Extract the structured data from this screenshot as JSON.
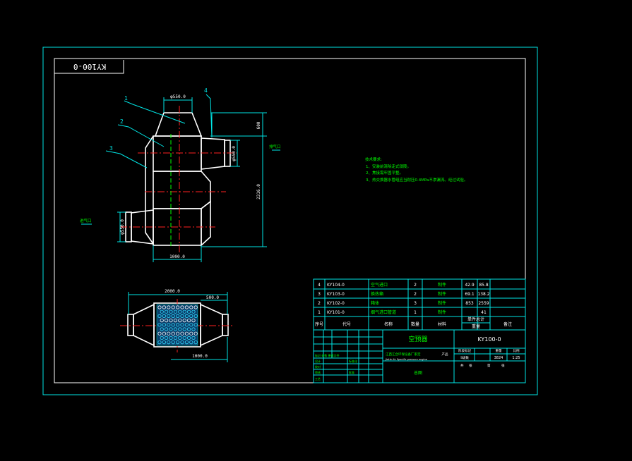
{
  "drawing": {
    "code_rotated": "KY100-0",
    "leaders": [
      "1",
      "2",
      "3",
      "4"
    ],
    "dims": {
      "top_diameter": "φ550.0",
      "outlet_diameter": "φ550.0",
      "inlet_diameter": "φ550.0",
      "small_height": "600",
      "total_height": "2316.0",
      "width_bottom": "1000.0",
      "lower_length": "2000.0",
      "lower_right": "500.0",
      "lower_bottom": "1000.0"
    },
    "flow_out": "排气口",
    "flow_in": "进气口"
  },
  "notes": {
    "title": "技术要求:",
    "lines": [
      "1、安装前清除走式锁陵。",
      "2、焦接需牢固平整。",
      "3、热交换器水管组应当耐压0.4MPa不渗漏流。经过试验。"
    ]
  },
  "bom": {
    "rows": [
      {
        "no": "4",
        "code": "KY104-0",
        "name": "空气进口",
        "qty": "2",
        "mat": "制件",
        "w1": "42.9",
        "w2": "85.8"
      },
      {
        "no": "3",
        "code": "KY103-0",
        "name": "换热箱",
        "qty": "2",
        "mat": "制件",
        "w1": "69.1",
        "w2": "138.2"
      },
      {
        "no": "2",
        "code": "KY102-0",
        "name": "箱体",
        "qty": "3",
        "mat": "制件",
        "w1": "853",
        "w2": "2559"
      },
      {
        "no": "1",
        "code": "KY101-0",
        "name": "烟气进口管道",
        "qty": "1",
        "mat": "制件",
        "w1": "",
        "w2": "41"
      }
    ],
    "header": {
      "no": "序号",
      "code": "代号",
      "name": "名称",
      "qty": "数量",
      "mat": "材料",
      "weight": "单件总计",
      "weight_unit": "重量",
      "remark": "备注"
    }
  },
  "titleblock": {
    "name": "空预器",
    "code": "KY100-0",
    "company": "江西江合环保设备厂家定",
    "company_en": "JiaHe Air Specific pressure engine",
    "product": "产品",
    "stage_label": "阶段标记",
    "weight_label": "重量",
    "scale_label": "比例",
    "weight": "3824",
    "scale": "1:25",
    "stage": "S级数",
    "sheets": "共",
    "sheet_no": "第",
    "sheet_word": "张",
    "drawing_kind": "总图",
    "sign_rows": [
      "标记 处数 更改文件",
      "设计",
      "校对",
      "审核",
      "工艺"
    ],
    "sign_cols": [
      "标准化",
      "批准"
    ]
  }
}
